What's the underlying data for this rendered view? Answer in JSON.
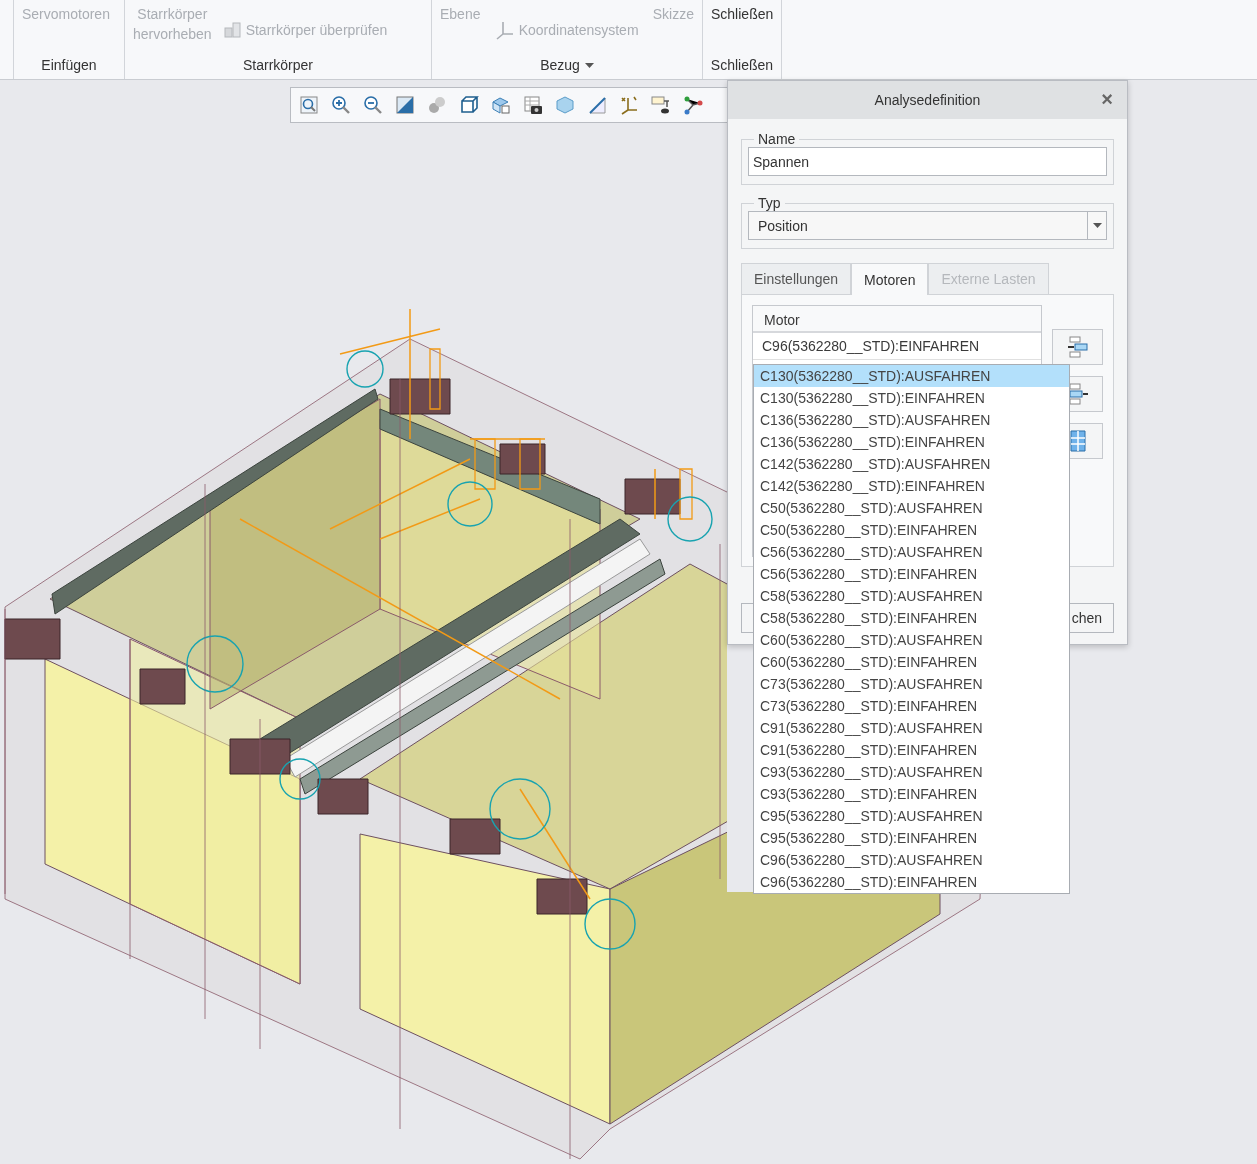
{
  "ribbon": {
    "groups": [
      {
        "label": "Einfügen",
        "has_menu": false,
        "items": [
          {
            "kind": "text",
            "label": "Servomotoren",
            "disabled": true
          }
        ]
      },
      {
        "label": "Starrkörper",
        "has_menu": false,
        "items": [
          {
            "kind": "text",
            "label": "Starrkörper\nhervorheben",
            "disabled": true
          },
          {
            "kind": "icon_text",
            "label": "Starrkörper überprüfen",
            "disabled": true
          }
        ]
      },
      {
        "label": "Bezug",
        "has_menu": true,
        "items": [
          {
            "kind": "text",
            "label": "Ebene",
            "disabled": true
          },
          {
            "kind": "icon_text",
            "label": "Koordinatensystem",
            "disabled": true
          },
          {
            "kind": "text",
            "label": "Skizze",
            "disabled": true
          }
        ]
      },
      {
        "label": "Schließen",
        "has_menu": false,
        "items": [
          {
            "kind": "text",
            "label": "Schließen",
            "disabled": false
          }
        ]
      }
    ]
  },
  "dialog": {
    "title": "Analysedefinition",
    "close": "×",
    "name_field": {
      "legend": "Name",
      "value": "Spannen"
    },
    "type_field": {
      "legend": "Typ",
      "value": "Position"
    },
    "tabs": [
      {
        "label": "Einstellungen",
        "selected": false,
        "disabled": false
      },
      {
        "label": "Motoren",
        "selected": true,
        "disabled": false
      },
      {
        "label": "Externe Lasten",
        "selected": false,
        "disabled": true
      }
    ],
    "motor_table": {
      "column": "Motor",
      "rows": [
        "C96(5362280__STD):EINFAHREN"
      ]
    },
    "buttons": [
      "chen"
    ]
  },
  "dropdown": {
    "items": [
      {
        "label": "C130(5362280__STD):AUSFAHREN",
        "selected": true
      },
      {
        "label": "C130(5362280__STD):EINFAHREN",
        "selected": false
      },
      {
        "label": "C136(5362280__STD):AUSFAHREN",
        "selected": false
      },
      {
        "label": "C136(5362280__STD):EINFAHREN",
        "selected": false
      },
      {
        "label": "C142(5362280__STD):AUSFAHREN",
        "selected": false
      },
      {
        "label": "C142(5362280__STD):EINFAHREN",
        "selected": false
      },
      {
        "label": "C50(5362280__STD):AUSFAHREN",
        "selected": false
      },
      {
        "label": "C50(5362280__STD):EINFAHREN",
        "selected": false
      },
      {
        "label": "C56(5362280__STD):AUSFAHREN",
        "selected": false
      },
      {
        "label": "C56(5362280__STD):EINFAHREN",
        "selected": false
      },
      {
        "label": "C58(5362280__STD):AUSFAHREN",
        "selected": false
      },
      {
        "label": "C58(5362280__STD):EINFAHREN",
        "selected": false
      },
      {
        "label": "C60(5362280__STD):AUSFAHREN",
        "selected": false
      },
      {
        "label": "C60(5362280__STD):EINFAHREN",
        "selected": false
      },
      {
        "label": "C73(5362280__STD):AUSFAHREN",
        "selected": false
      },
      {
        "label": "C73(5362280__STD):EINFAHREN",
        "selected": false
      },
      {
        "label": "C91(5362280__STD):AUSFAHREN",
        "selected": false
      },
      {
        "label": "C91(5362280__STD):EINFAHREN",
        "selected": false
      },
      {
        "label": "C93(5362280__STD):AUSFAHREN",
        "selected": false
      },
      {
        "label": "C93(5362280__STD):EINFAHREN",
        "selected": false
      },
      {
        "label": "C95(5362280__STD):AUSFAHREN",
        "selected": false
      },
      {
        "label": "C95(5362280__STD):EINFAHREN",
        "selected": false
      },
      {
        "label": "C96(5362280__STD):AUSFAHREN",
        "selected": false
      },
      {
        "label": "C96(5362280__STD):EINFAHREN",
        "selected": false
      }
    ]
  }
}
